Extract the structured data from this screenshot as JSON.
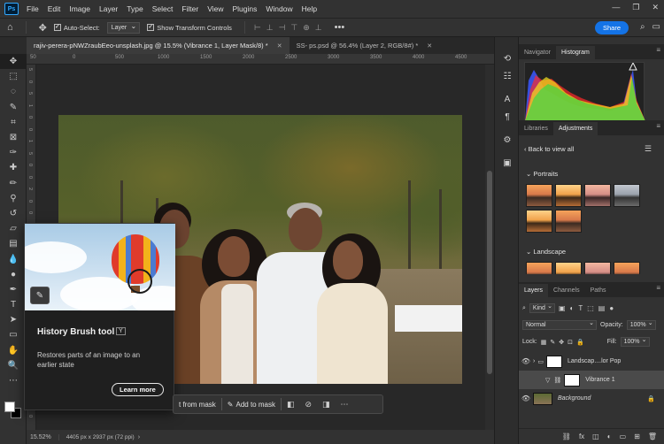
{
  "app": {
    "logo": "Ps",
    "menu": [
      "File",
      "Edit",
      "Image",
      "Layer",
      "Type",
      "Select",
      "Filter",
      "View",
      "Plugins",
      "Window",
      "Help"
    ]
  },
  "options": {
    "auto_select_label": "Auto-Select:",
    "auto_select_value": "Layer",
    "show_transform_label": "Show Transform Controls",
    "share_label": "Share"
  },
  "tabs": [
    {
      "label": "rajiv-perera-pNWZraubEeo-unsplash.jpg @ 15.5% (Vibrance 1, Layer Mask/8) *",
      "active": true
    },
    {
      "label": "SS- ps.psd @ 56.4% (Layer 2, RGB/8#) *",
      "active": false
    }
  ],
  "ruler": {
    "top": [
      "50",
      "0",
      "500",
      "1000",
      "1500",
      "2000",
      "2500",
      "3000",
      "3500",
      "4000",
      "4500"
    ],
    "left": [
      "5",
      "0",
      "5",
      "1",
      "0",
      "0",
      "1",
      "5",
      "0",
      "0",
      "2",
      "0",
      "0",
      "0",
      "2",
      "5",
      "0",
      "0",
      "3",
      "0",
      "0",
      "0",
      "3",
      "5",
      "0",
      "0",
      "4",
      "0",
      "0",
      "0"
    ]
  },
  "tooltip": {
    "title": "History Brush tool",
    "shortcut": "Y",
    "description": "Restores parts of an image to an earlier state",
    "learn_more": "Learn more"
  },
  "taskbar": {
    "subtract_label": "t from mask",
    "add_label": "Add to mask"
  },
  "status": {
    "zoom": "15.52%",
    "doc_info": "4405 px x 2937 px (72 ppi)"
  },
  "panels": {
    "top_tabs": [
      "Navigator",
      "Histogram"
    ],
    "mid_tabs": [
      "Libraries",
      "Adjustments"
    ],
    "back_label": "Back to view all",
    "section_portraits": "Portraits",
    "section_landscape": "Landscape",
    "layer_tabs": [
      "Layers",
      "Channels",
      "Paths"
    ],
    "kind_label": "Kind",
    "blend_mode": "Normal",
    "opacity_label": "Opacity:",
    "opacity_value": "100%",
    "lock_label": "Lock:",
    "fill_label": "Fill:",
    "fill_value": "100%",
    "layers": [
      {
        "name": "Landscap....lor Pop",
        "type": "group"
      },
      {
        "name": "Vibrance 1",
        "type": "adjustment",
        "selected": true
      },
      {
        "name": "Background",
        "type": "image",
        "locked": true
      }
    ]
  },
  "colors": {
    "accent": "#1473e6",
    "foreground": "#ffffff",
    "background": "#000000"
  }
}
